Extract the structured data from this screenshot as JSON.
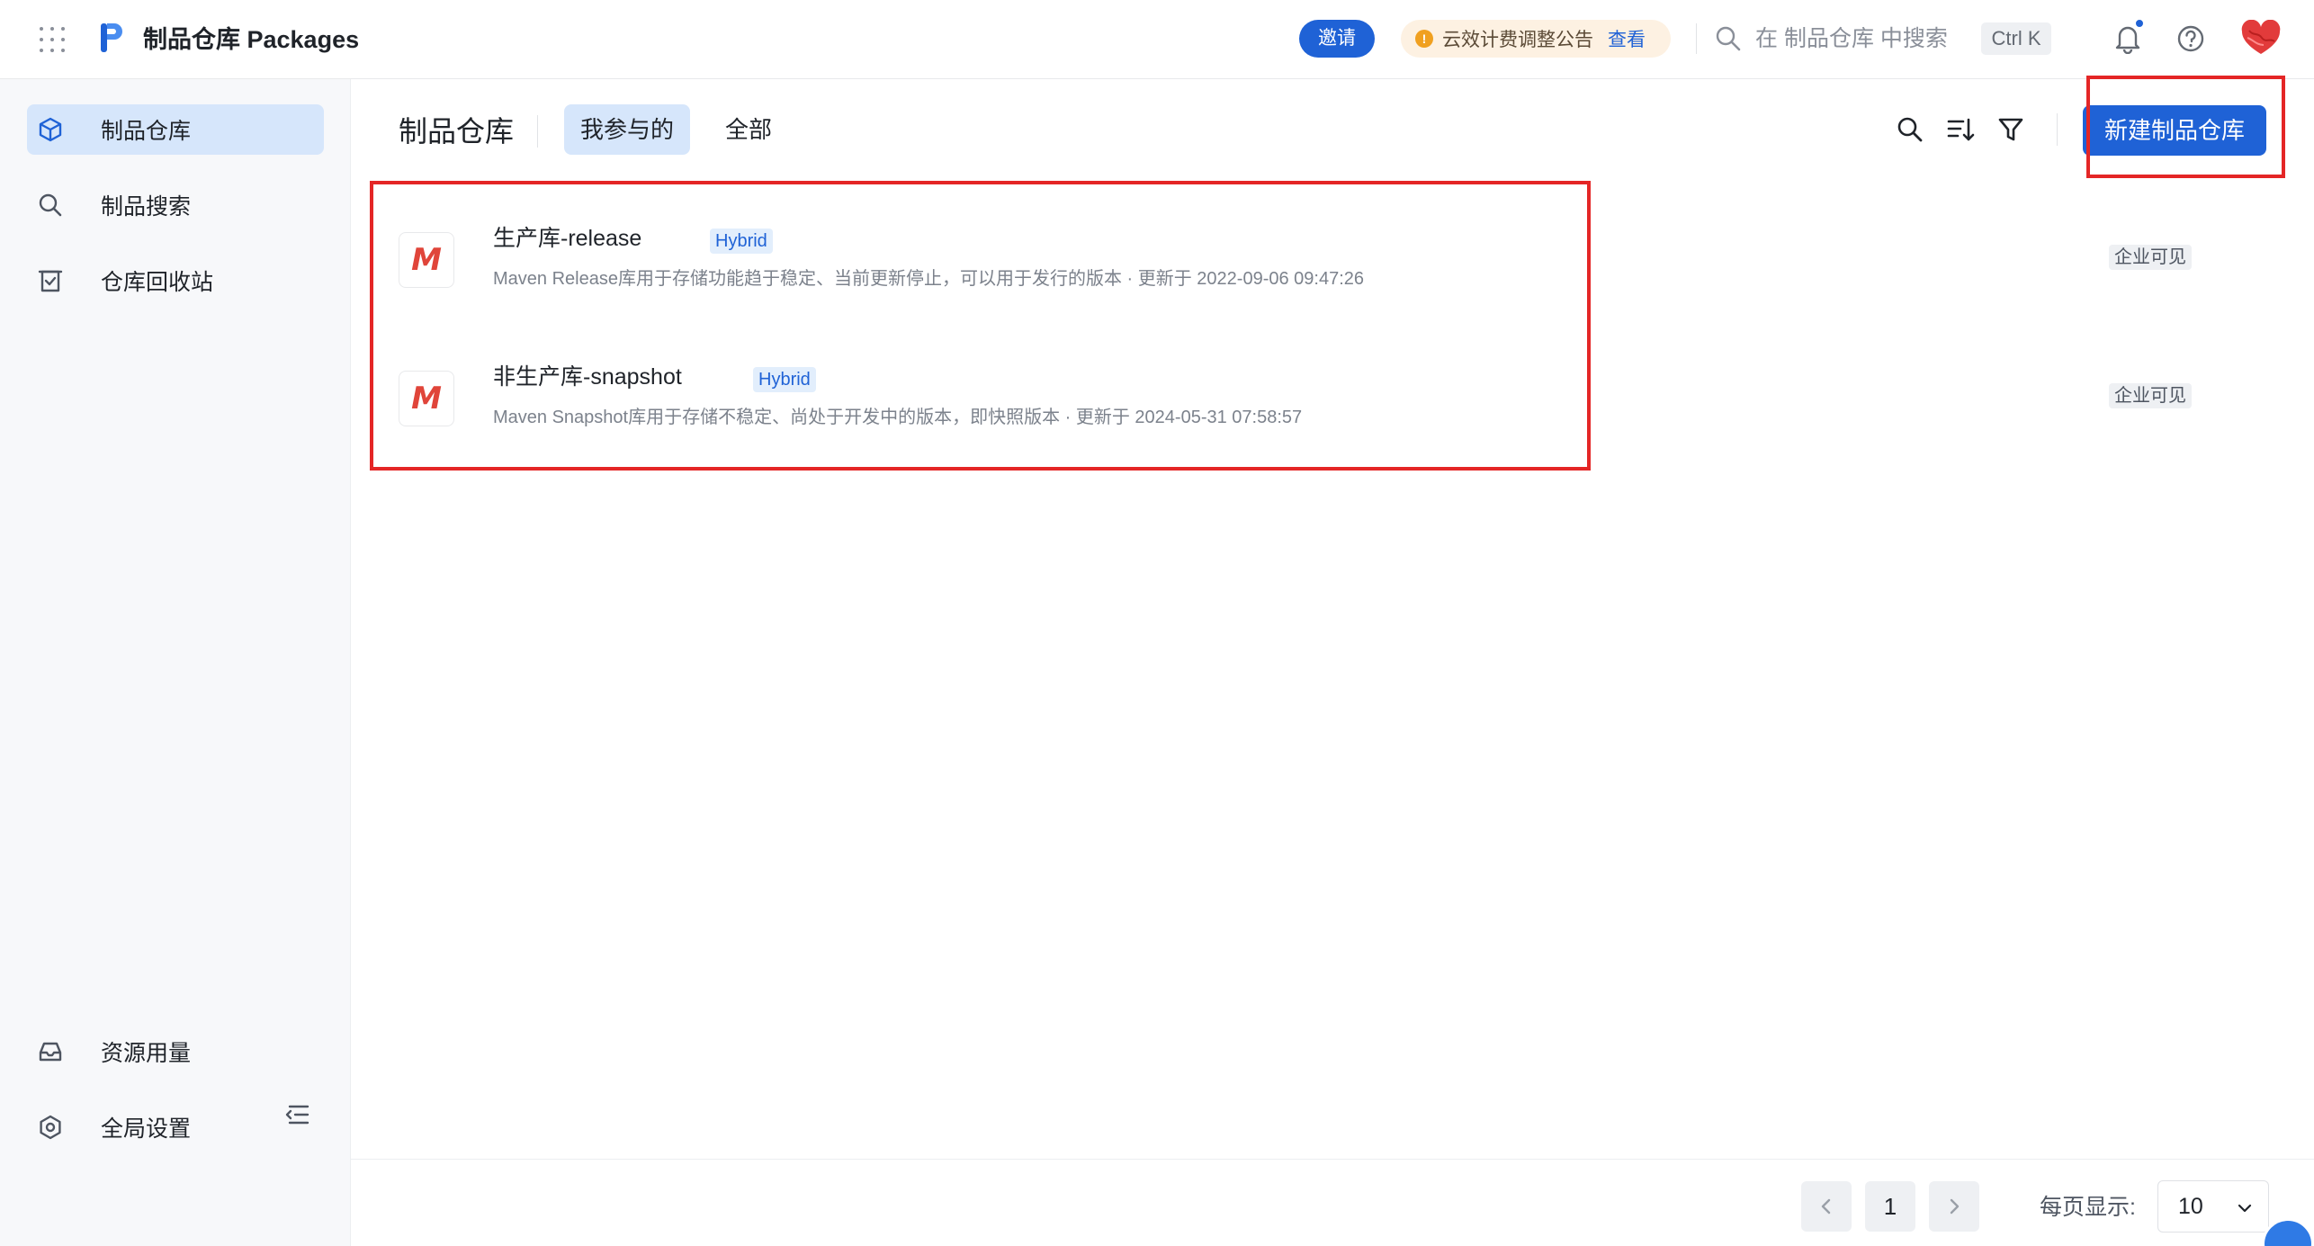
{
  "header": {
    "brand_title": "制品仓库 Packages",
    "invite_label": "邀请",
    "notice_text": "云效计费调整公告",
    "notice_link": "查看",
    "search_placeholder": "在 制品仓库 中搜索",
    "search_shortcut": "Ctrl K"
  },
  "sidebar": {
    "items": [
      {
        "label": "制品仓库",
        "icon": "package-icon",
        "active": true
      },
      {
        "label": "制品搜索",
        "icon": "search-icon",
        "active": false
      },
      {
        "label": "仓库回收站",
        "icon": "recycle-bin-icon",
        "active": false
      }
    ],
    "bottom_items": [
      {
        "label": "资源用量",
        "icon": "inbox-icon"
      },
      {
        "label": "全局设置",
        "icon": "settings-icon"
      }
    ]
  },
  "main": {
    "title": "制品仓库",
    "tabs": [
      {
        "label": "我参与的",
        "active": true
      },
      {
        "label": "全部",
        "active": false
      }
    ],
    "new_button_label": "新建制品仓库",
    "repos": [
      {
        "logo_text": "M",
        "name": "生产库-release",
        "tag": "Hybrid",
        "description": "Maven Release库用于存储功能趋于稳定、当前更新停止，可以用于发行的版本 · 更新于 2022-09-06 09:47:26",
        "visibility": "企业可见"
      },
      {
        "logo_text": "M",
        "name": "非生产库-snapshot",
        "tag": "Hybrid",
        "description": "Maven Snapshot库用于存储不稳定、尚处于开发中的版本，即快照版本 · 更新于 2024-05-31 07:58:57",
        "visibility": "企业可见"
      }
    ]
  },
  "pagination": {
    "current_page": "1",
    "page_size_label": "每页显示:",
    "page_size": "10"
  },
  "colors": {
    "primary": "#1f62d6",
    "active_bg": "#d6e6fb",
    "highlight_box": "#e42626",
    "maven_logo": "#e0453a"
  }
}
